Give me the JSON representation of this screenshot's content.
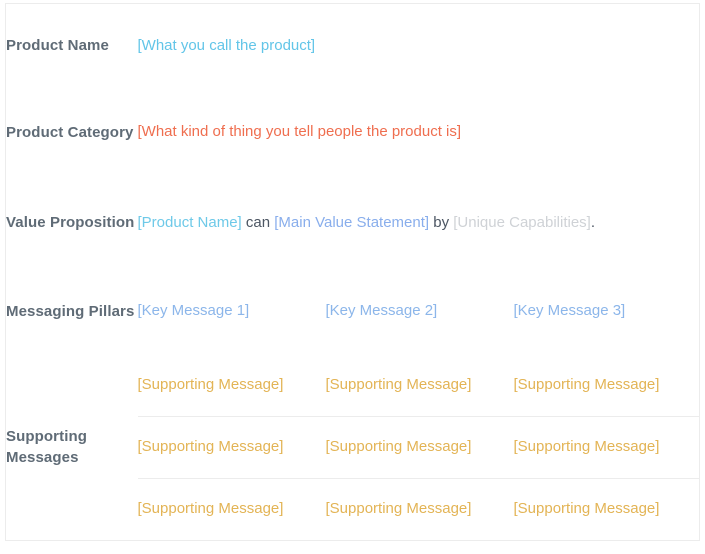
{
  "table": {
    "rows": [
      {
        "label": "Product Name",
        "type": "single",
        "value": "[What you call the product]",
        "color_token": "name"
      },
      {
        "label": "Product Category",
        "type": "single",
        "value": "[What kind of thing you tell people the product is]",
        "color_token": "category"
      },
      {
        "label": "Value Proposition",
        "type": "sentence",
        "segments": [
          {
            "text": "[Product Name]",
            "color_token": "product"
          },
          {
            "text": " can ",
            "color_token": "plain"
          },
          {
            "text": "[Main Value Statement]",
            "color_token": "mainvalue"
          },
          {
            "text": " by ",
            "color_token": "plain"
          },
          {
            "text": "[Unique Capabilities]",
            "color_token": "unique"
          },
          {
            "text": ".",
            "color_token": "plain"
          }
        ]
      },
      {
        "label": "Messaging Pillars",
        "type": "columns",
        "cells": [
          "[Key Message 1]",
          "[Key Message 2]",
          "[Key Message 3]"
        ],
        "color_token": "pillar"
      },
      {
        "label": "Supporting Messages",
        "type": "grid",
        "grid": [
          [
            "[Supporting Message]",
            "[Supporting Message]",
            "[Supporting Message]"
          ],
          [
            "[Supporting Message]",
            "[Supporting Message]",
            "[Supporting Message]"
          ],
          [
            "[Supporting Message]",
            "[Supporting Message]",
            "[Supporting Message]"
          ]
        ],
        "color_token": "support"
      }
    ]
  },
  "colors": {
    "label_text": "#5f6b76",
    "border": "#ececec",
    "background": "#ffffff",
    "name": "#62c5e8",
    "category": "#ef6e4f",
    "product": "#6ec9e8",
    "mainvalue": "#89aeec",
    "unique": "#cfd2d6",
    "plain": "#4c5663",
    "pillar": "#8cb6ea",
    "support": "#e3b455"
  }
}
